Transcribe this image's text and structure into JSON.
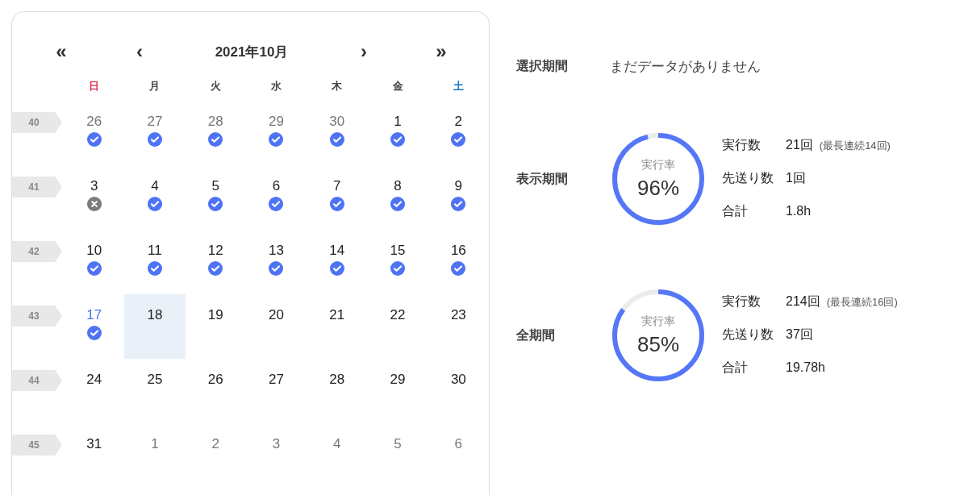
{
  "calendar": {
    "nav": {
      "prev_year": "«",
      "prev_month": "‹",
      "title": "2021年10月",
      "next_month": "›",
      "next_year": "»"
    },
    "weekdays": [
      {
        "label": "日",
        "kind": "sunday"
      },
      {
        "label": "月",
        "kind": "weekday"
      },
      {
        "label": "火",
        "kind": "weekday"
      },
      {
        "label": "水",
        "kind": "weekday"
      },
      {
        "label": "木",
        "kind": "weekday"
      },
      {
        "label": "金",
        "kind": "weekday"
      },
      {
        "label": "土",
        "kind": "saturday"
      }
    ],
    "weeks": [
      {
        "number": "40",
        "days": [
          {
            "label": "26",
            "other_month": true,
            "today": false,
            "selected": false,
            "kind": "done"
          },
          {
            "label": "27",
            "other_month": true,
            "today": false,
            "selected": false,
            "kind": "done"
          },
          {
            "label": "28",
            "other_month": true,
            "today": false,
            "selected": false,
            "kind": "done"
          },
          {
            "label": "29",
            "other_month": true,
            "today": false,
            "selected": false,
            "kind": "done"
          },
          {
            "label": "30",
            "other_month": true,
            "today": false,
            "selected": false,
            "kind": "done"
          },
          {
            "label": "1",
            "other_month": false,
            "today": false,
            "selected": false,
            "kind": "done"
          },
          {
            "label": "2",
            "other_month": false,
            "today": false,
            "selected": false,
            "kind": "done"
          }
        ]
      },
      {
        "number": "41",
        "days": [
          {
            "label": "3",
            "other_month": false,
            "today": false,
            "selected": false,
            "kind": "skipped"
          },
          {
            "label": "4",
            "other_month": false,
            "today": false,
            "selected": false,
            "kind": "done"
          },
          {
            "label": "5",
            "other_month": false,
            "today": false,
            "selected": false,
            "kind": "done"
          },
          {
            "label": "6",
            "other_month": false,
            "today": false,
            "selected": false,
            "kind": "done"
          },
          {
            "label": "7",
            "other_month": false,
            "today": false,
            "selected": false,
            "kind": "done"
          },
          {
            "label": "8",
            "other_month": false,
            "today": false,
            "selected": false,
            "kind": "done"
          },
          {
            "label": "9",
            "other_month": false,
            "today": false,
            "selected": false,
            "kind": "done"
          }
        ]
      },
      {
        "number": "42",
        "days": [
          {
            "label": "10",
            "other_month": false,
            "today": false,
            "selected": false,
            "kind": "done"
          },
          {
            "label": "11",
            "other_month": false,
            "today": false,
            "selected": false,
            "kind": "done"
          },
          {
            "label": "12",
            "other_month": false,
            "today": false,
            "selected": false,
            "kind": "done"
          },
          {
            "label": "13",
            "other_month": false,
            "today": false,
            "selected": false,
            "kind": "done"
          },
          {
            "label": "14",
            "other_month": false,
            "today": false,
            "selected": false,
            "kind": "done"
          },
          {
            "label": "15",
            "other_month": false,
            "today": false,
            "selected": false,
            "kind": "done"
          },
          {
            "label": "16",
            "other_month": false,
            "today": false,
            "selected": false,
            "kind": "done"
          }
        ]
      },
      {
        "number": "43",
        "days": [
          {
            "label": "17",
            "other_month": false,
            "today": true,
            "selected": false,
            "kind": "done"
          },
          {
            "label": "18",
            "other_month": false,
            "today": false,
            "selected": true,
            "kind": "empty"
          },
          {
            "label": "19",
            "other_month": false,
            "today": false,
            "selected": false,
            "kind": "empty"
          },
          {
            "label": "20",
            "other_month": false,
            "today": false,
            "selected": false,
            "kind": "empty"
          },
          {
            "label": "21",
            "other_month": false,
            "today": false,
            "selected": false,
            "kind": "empty"
          },
          {
            "label": "22",
            "other_month": false,
            "today": false,
            "selected": false,
            "kind": "empty"
          },
          {
            "label": "23",
            "other_month": false,
            "today": false,
            "selected": false,
            "kind": "empty"
          }
        ]
      },
      {
        "number": "44",
        "days": [
          {
            "label": "24",
            "other_month": false,
            "today": false,
            "selected": false,
            "kind": "empty"
          },
          {
            "label": "25",
            "other_month": false,
            "today": false,
            "selected": false,
            "kind": "empty"
          },
          {
            "label": "26",
            "other_month": false,
            "today": false,
            "selected": false,
            "kind": "empty"
          },
          {
            "label": "27",
            "other_month": false,
            "today": false,
            "selected": false,
            "kind": "empty"
          },
          {
            "label": "28",
            "other_month": false,
            "today": false,
            "selected": false,
            "kind": "empty"
          },
          {
            "label": "29",
            "other_month": false,
            "today": false,
            "selected": false,
            "kind": "empty"
          },
          {
            "label": "30",
            "other_month": false,
            "today": false,
            "selected": false,
            "kind": "empty"
          }
        ]
      },
      {
        "number": "45",
        "days": [
          {
            "label": "31",
            "other_month": false,
            "today": false,
            "selected": false,
            "kind": "empty"
          },
          {
            "label": "1",
            "other_month": true,
            "today": false,
            "selected": false,
            "kind": "empty"
          },
          {
            "label": "2",
            "other_month": true,
            "today": false,
            "selected": false,
            "kind": "empty"
          },
          {
            "label": "3",
            "other_month": true,
            "today": false,
            "selected": false,
            "kind": "empty"
          },
          {
            "label": "4",
            "other_month": true,
            "today": false,
            "selected": false,
            "kind": "empty"
          },
          {
            "label": "5",
            "other_month": true,
            "today": false,
            "selected": false,
            "kind": "empty"
          },
          {
            "label": "6",
            "other_month": true,
            "today": false,
            "selected": false,
            "kind": "empty"
          }
        ]
      }
    ]
  },
  "selection": {
    "label": "選択期間",
    "value": "まだデータがありません"
  },
  "periods": [
    {
      "label": "表示期間",
      "ring_label": "実行率",
      "rate": "96%",
      "level": 0.96,
      "stats": [
        {
          "label": "実行数",
          "value": "21回",
          "note": "(最長連続14回)"
        },
        {
          "label": "先送り数",
          "value": "1回"
        },
        {
          "label": "合計",
          "value": "1.8h"
        }
      ]
    },
    {
      "label": "全期間",
      "ring_label": "実行率",
      "rate": "85%",
      "level": 0.85,
      "stats": [
        {
          "label": "実行数",
          "value": "214回",
          "note": "(最長連続16回)"
        },
        {
          "label": "先送り数",
          "value": "37回"
        },
        {
          "label": "合計",
          "value": "19.78h"
        }
      ]
    }
  ]
}
